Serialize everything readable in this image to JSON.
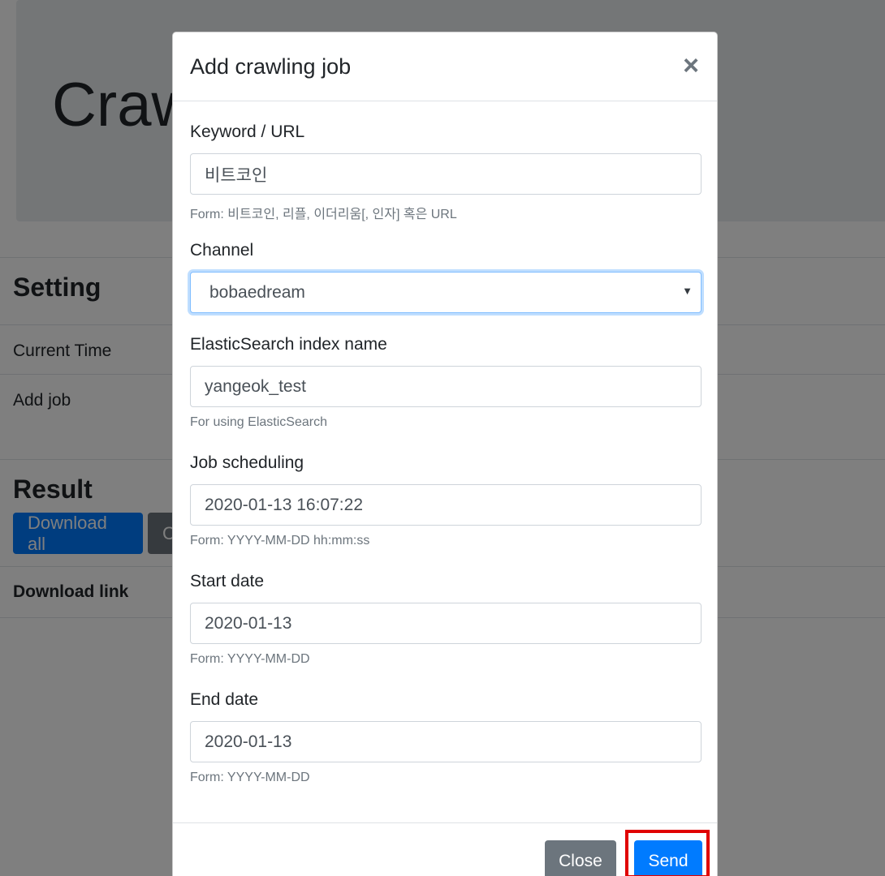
{
  "background": {
    "jumbotron_title": "Craw",
    "setting_title": "Setting",
    "current_time_label": "Current Time",
    "add_job_label": "Add job",
    "result_title": "Result",
    "download_all_label": "Download all",
    "secondary_btn_label": "C",
    "download_link_label": "Download link"
  },
  "modal": {
    "title": "Add crawling job",
    "close_icon": "×",
    "fields": {
      "keyword": {
        "label": "Keyword / URL",
        "value": "비트코인",
        "help": "Form: 비트코인, 리플, 이더리움[, 인자] 혹은 URL"
      },
      "channel": {
        "label": "Channel",
        "value": "bobaedream"
      },
      "es_index": {
        "label": "ElasticSearch index name",
        "value": "yangeok_test",
        "help": "For using ElasticSearch"
      },
      "schedule": {
        "label": "Job scheduling",
        "value": "2020-01-13 16:07:22",
        "help": "Form: YYYY-MM-DD hh:mm:ss"
      },
      "start_date": {
        "label": "Start date",
        "value": "2020-01-13",
        "help": "Form: YYYY-MM-DD"
      },
      "end_date": {
        "label": "End date",
        "value": "2020-01-13",
        "help": "Form: YYYY-MM-DD"
      }
    },
    "footer": {
      "close_label": "Close",
      "send_label": "Send"
    }
  },
  "colors": {
    "primary": "#007bff",
    "secondary": "#6c757d",
    "highlight": "#e00000"
  }
}
